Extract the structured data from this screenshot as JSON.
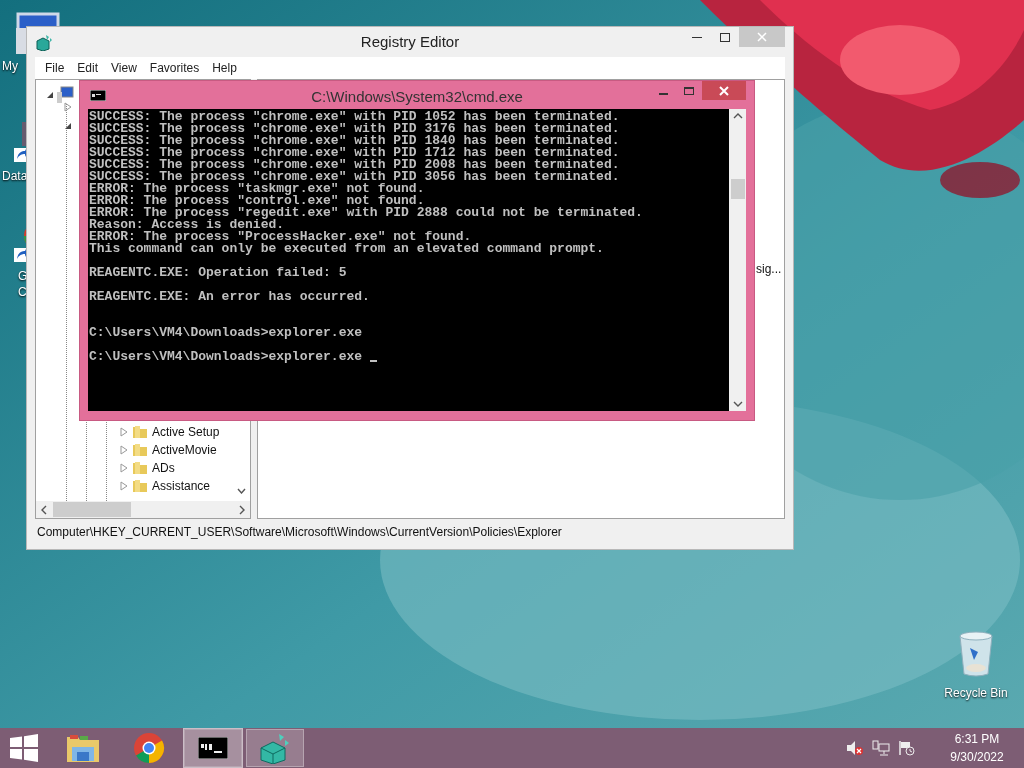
{
  "desktop_icons": [
    {
      "kind": "computer",
      "label_lines": [
        "My"
      ]
    },
    {
      "kind": "shortcut",
      "label_lines": [
        "Data"
      ]
    },
    {
      "kind": "chrome",
      "label_lines": [
        "G",
        "C"
      ]
    }
  ],
  "recycle_bin": {
    "label": "Recycle Bin"
  },
  "regedit": {
    "title": "Registry Editor",
    "menu": [
      "File",
      "Edit",
      "View",
      "Favorites",
      "Help"
    ],
    "tree": [
      {
        "label": "Active Setup"
      },
      {
        "label": "ActiveMovie"
      },
      {
        "label": "ADs"
      },
      {
        "label": "Assistance"
      }
    ],
    "right_pane_text": "sig...",
    "status_bar": "Computer\\HKEY_CURRENT_USER\\Software\\Microsoft\\Windows\\CurrentVersion\\Policies\\Explorer"
  },
  "cmd": {
    "title": "C:\\Windows\\System32\\cmd.exe",
    "output_blocks": [
      [
        "SUCCESS: The process \"chrome.exe\" with PID 1052 has been terminated.",
        "SUCCESS: The process \"chrome.exe\" with PID 3176 has been terminated.",
        "SUCCESS: The process \"chrome.exe\" with PID 1840 has been terminated.",
        "SUCCESS: The process \"chrome.exe\" with PID 1712 has been terminated.",
        "SUCCESS: The process \"chrome.exe\" with PID 2008 has been terminated.",
        "SUCCESS: The process \"chrome.exe\" with PID 3056 has been terminated.",
        "ERROR: The process \"taskmgr.exe\" not found.",
        "ERROR: The process \"control.exe\" not found.",
        "ERROR: The process \"regedit.exe\" with PID 2888 could not be terminated.",
        "Reason: Access is denied.",
        "ERROR: The process \"ProcessHacker.exe\" not found.",
        "This command can only be executed from an elevated command prompt."
      ],
      [
        "REAGENTC.EXE: Operation failed: 5"
      ],
      [
        "REAGENTC.EXE: An error has occurred."
      ]
    ],
    "prompt_lines": [
      "C:\\Users\\VM4\\Downloads>explorer.exe",
      "C:\\Users\\VM4\\Downloads>explorer.exe "
    ],
    "cursor": true
  },
  "taskbar": {
    "buttons": [
      {
        "kind": "start",
        "running": false,
        "active": false
      },
      {
        "kind": "explorer",
        "running": false,
        "active": false
      },
      {
        "kind": "chrome",
        "running": false,
        "active": false
      },
      {
        "kind": "cmd",
        "running": true,
        "active": true
      },
      {
        "kind": "regedit",
        "running": true,
        "active": false
      }
    ],
    "tray": {
      "time": "6:31 PM",
      "date": "9/30/2022"
    }
  }
}
